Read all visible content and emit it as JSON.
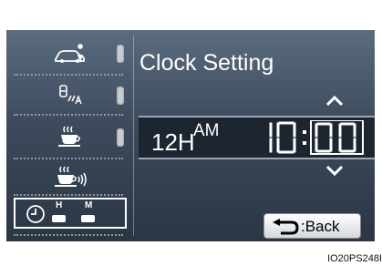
{
  "screen": {
    "title": "Clock Setting",
    "format": "12H",
    "ampm": "AM",
    "hour": "10",
    "colon": ":",
    "minute": "00",
    "back_label": ":Back"
  },
  "sidebar": {
    "items": [
      {
        "icon": "car-lights-icon"
      },
      {
        "icon": "auto-headlight-icon"
      },
      {
        "icon": "coffee-cup-icon"
      },
      {
        "icon": "coffee-cup-sound-icon"
      },
      {
        "icon": "clock-hm-icon",
        "h_label": "H",
        "m_label": "M"
      }
    ]
  },
  "image_code": "IO20PS248I"
}
